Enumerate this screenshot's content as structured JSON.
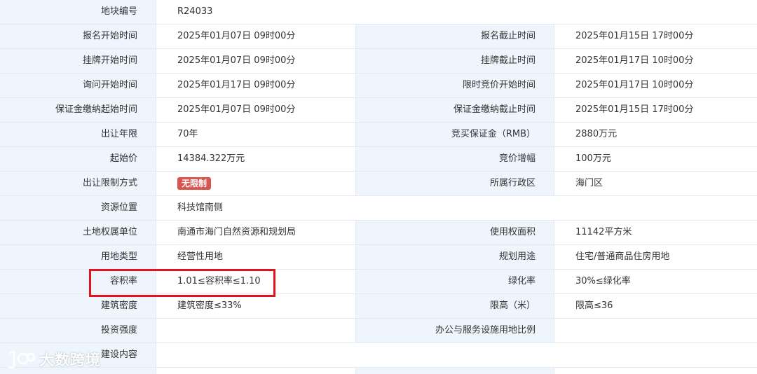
{
  "rows": [
    {
      "label1": "地块编号",
      "value1": "R24033"
    },
    {
      "label1": "报名开始时间",
      "value1": "2025年01月07日 09时00分",
      "label2": "报名截止时间",
      "value2": "2025年01月15日 17时00分"
    },
    {
      "label1": "挂牌开始时间",
      "value1": "2025年01月07日 09时00分",
      "label2": "挂牌截止时间",
      "value2": "2025年01月17日 10时00分"
    },
    {
      "label1": "询问开始时间",
      "value1": "2025年01月17日 09时00分",
      "label2": "限时竞价开始时间",
      "value2": "2025年01月17日 10时00分"
    },
    {
      "label1": "保证金缴纳起始时间",
      "value1": "2025年01月07日 09时00分",
      "label2": "保证金缴纳截止时间",
      "value2": "2025年01月15日 17时00分"
    },
    {
      "label1": "出让年限",
      "value1": "70年",
      "label2": "竞买保证金（RMB）",
      "value2": "2880万元"
    },
    {
      "label1": "起始价",
      "value1": "14384.322万元",
      "label2": "竞价增幅",
      "value2": "100万元"
    },
    {
      "label1": "出让限制方式",
      "value1": "无限制",
      "label2": "所属行政区",
      "value2": "海门区"
    },
    {
      "label1": "资源位置",
      "value1": "科技馆南侧"
    },
    {
      "label1": "土地权属单位",
      "value1": "南通市海门自然资源和规划局",
      "label2": "使用权面积",
      "value2": "11142平方米"
    },
    {
      "label1": "用地类型",
      "value1": "经营性用地",
      "label2": "规划用途",
      "value2": "住宅/普通商品住房用地"
    },
    {
      "label1": "容积率",
      "value1": "1.01≤容积率≤1.10",
      "label2": "绿化率",
      "value2": "30%≤绿化率"
    },
    {
      "label1": "建筑密度",
      "value1": "建筑密度≤33%",
      "label2": "限高（米）",
      "value2": "限高≤36"
    },
    {
      "label1": "投资强度",
      "value1": "",
      "label2": "办公与服务设施用地比例",
      "value2": ""
    },
    {
      "label1": "建设内容",
      "value1": ""
    }
  ],
  "watermark": {
    "text": "大数跨境"
  },
  "colors": {
    "label_bg": "#eef5fc",
    "border": "#e3e9f0",
    "tag_bg": "#d9534f",
    "highlight": "#e0141e"
  }
}
